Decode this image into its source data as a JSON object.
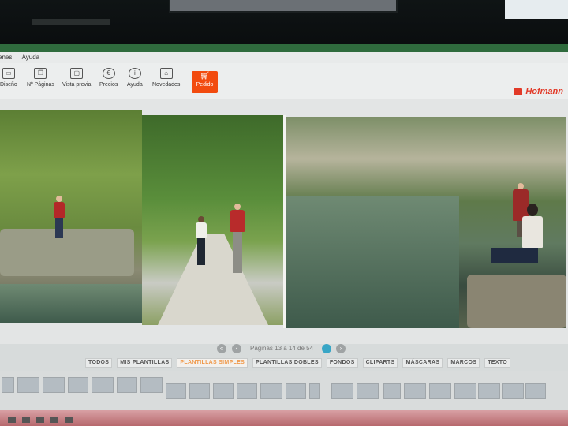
{
  "window": {
    "title": "",
    "menu": [
      "enes",
      "Ayuda"
    ]
  },
  "toolbar": {
    "items": [
      {
        "label": "Diseño",
        "icon": "layout-icon"
      },
      {
        "label": "Nº Páginas",
        "icon": "pages-icon"
      },
      {
        "label": "Vista previa",
        "icon": "preview-icon"
      },
      {
        "label": "Precios",
        "icon": "euro-icon"
      },
      {
        "label": "Ayuda",
        "icon": "info-icon"
      },
      {
        "label": "Novedades",
        "icon": "home-icon"
      }
    ],
    "order_label": "Pedido",
    "brand": "Hofmann"
  },
  "pagenav": {
    "left_text": "",
    "page_text": "Páginas 13 a 14 de 54",
    "right_text": ""
  },
  "tabs": [
    "TODOS",
    "MIS PLANTILLAS",
    "PLANTILLAS SIMPLES",
    "PLANTILLAS DOBLES",
    "FONDOS",
    "CLIPARTS",
    "MÁSCARAS",
    "MARCOS",
    "TEXTO"
  ],
  "colors": {
    "accent": "#f24b0f",
    "active_tab": "#f0994a",
    "page_indicator": "#38a6c6",
    "brand": "#e23a28"
  }
}
